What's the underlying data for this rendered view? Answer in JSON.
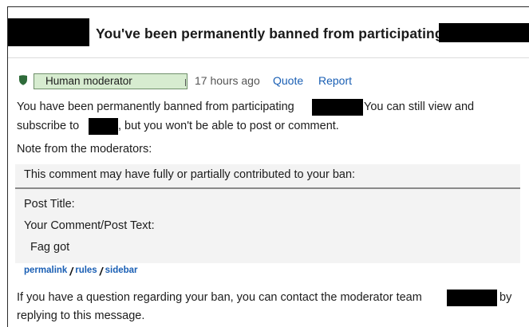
{
  "header": {
    "title": "You've been permanently banned from participating"
  },
  "meta": {
    "author_label": "Human moderator",
    "time_ago": "17 hours ago",
    "quote_label": "Quote",
    "report_label": "Report",
    "shield_color": "#2e6b3a"
  },
  "message": {
    "line1_start": "You have been permanently banned from participating",
    "line1_end": "You can still view and",
    "line2_start": "subscribe to",
    "line2_end": ", but you won't be able to post or comment.",
    "note_heading": "Note from the moderators:",
    "footer_line1_start": "If you have a question regarding your ban, you can contact the moderator team",
    "footer_line1_end": "by",
    "footer_line2": "replying to this message."
  },
  "quote": {
    "heading": "This comment may have fully or partially contributed to your ban:",
    "post_title_label": "Post Title:",
    "comment_label": "Your Comment/Post Text:",
    "comment_text": "Fag got",
    "links": [
      "permalink",
      "rules",
      "sidebar"
    ]
  }
}
